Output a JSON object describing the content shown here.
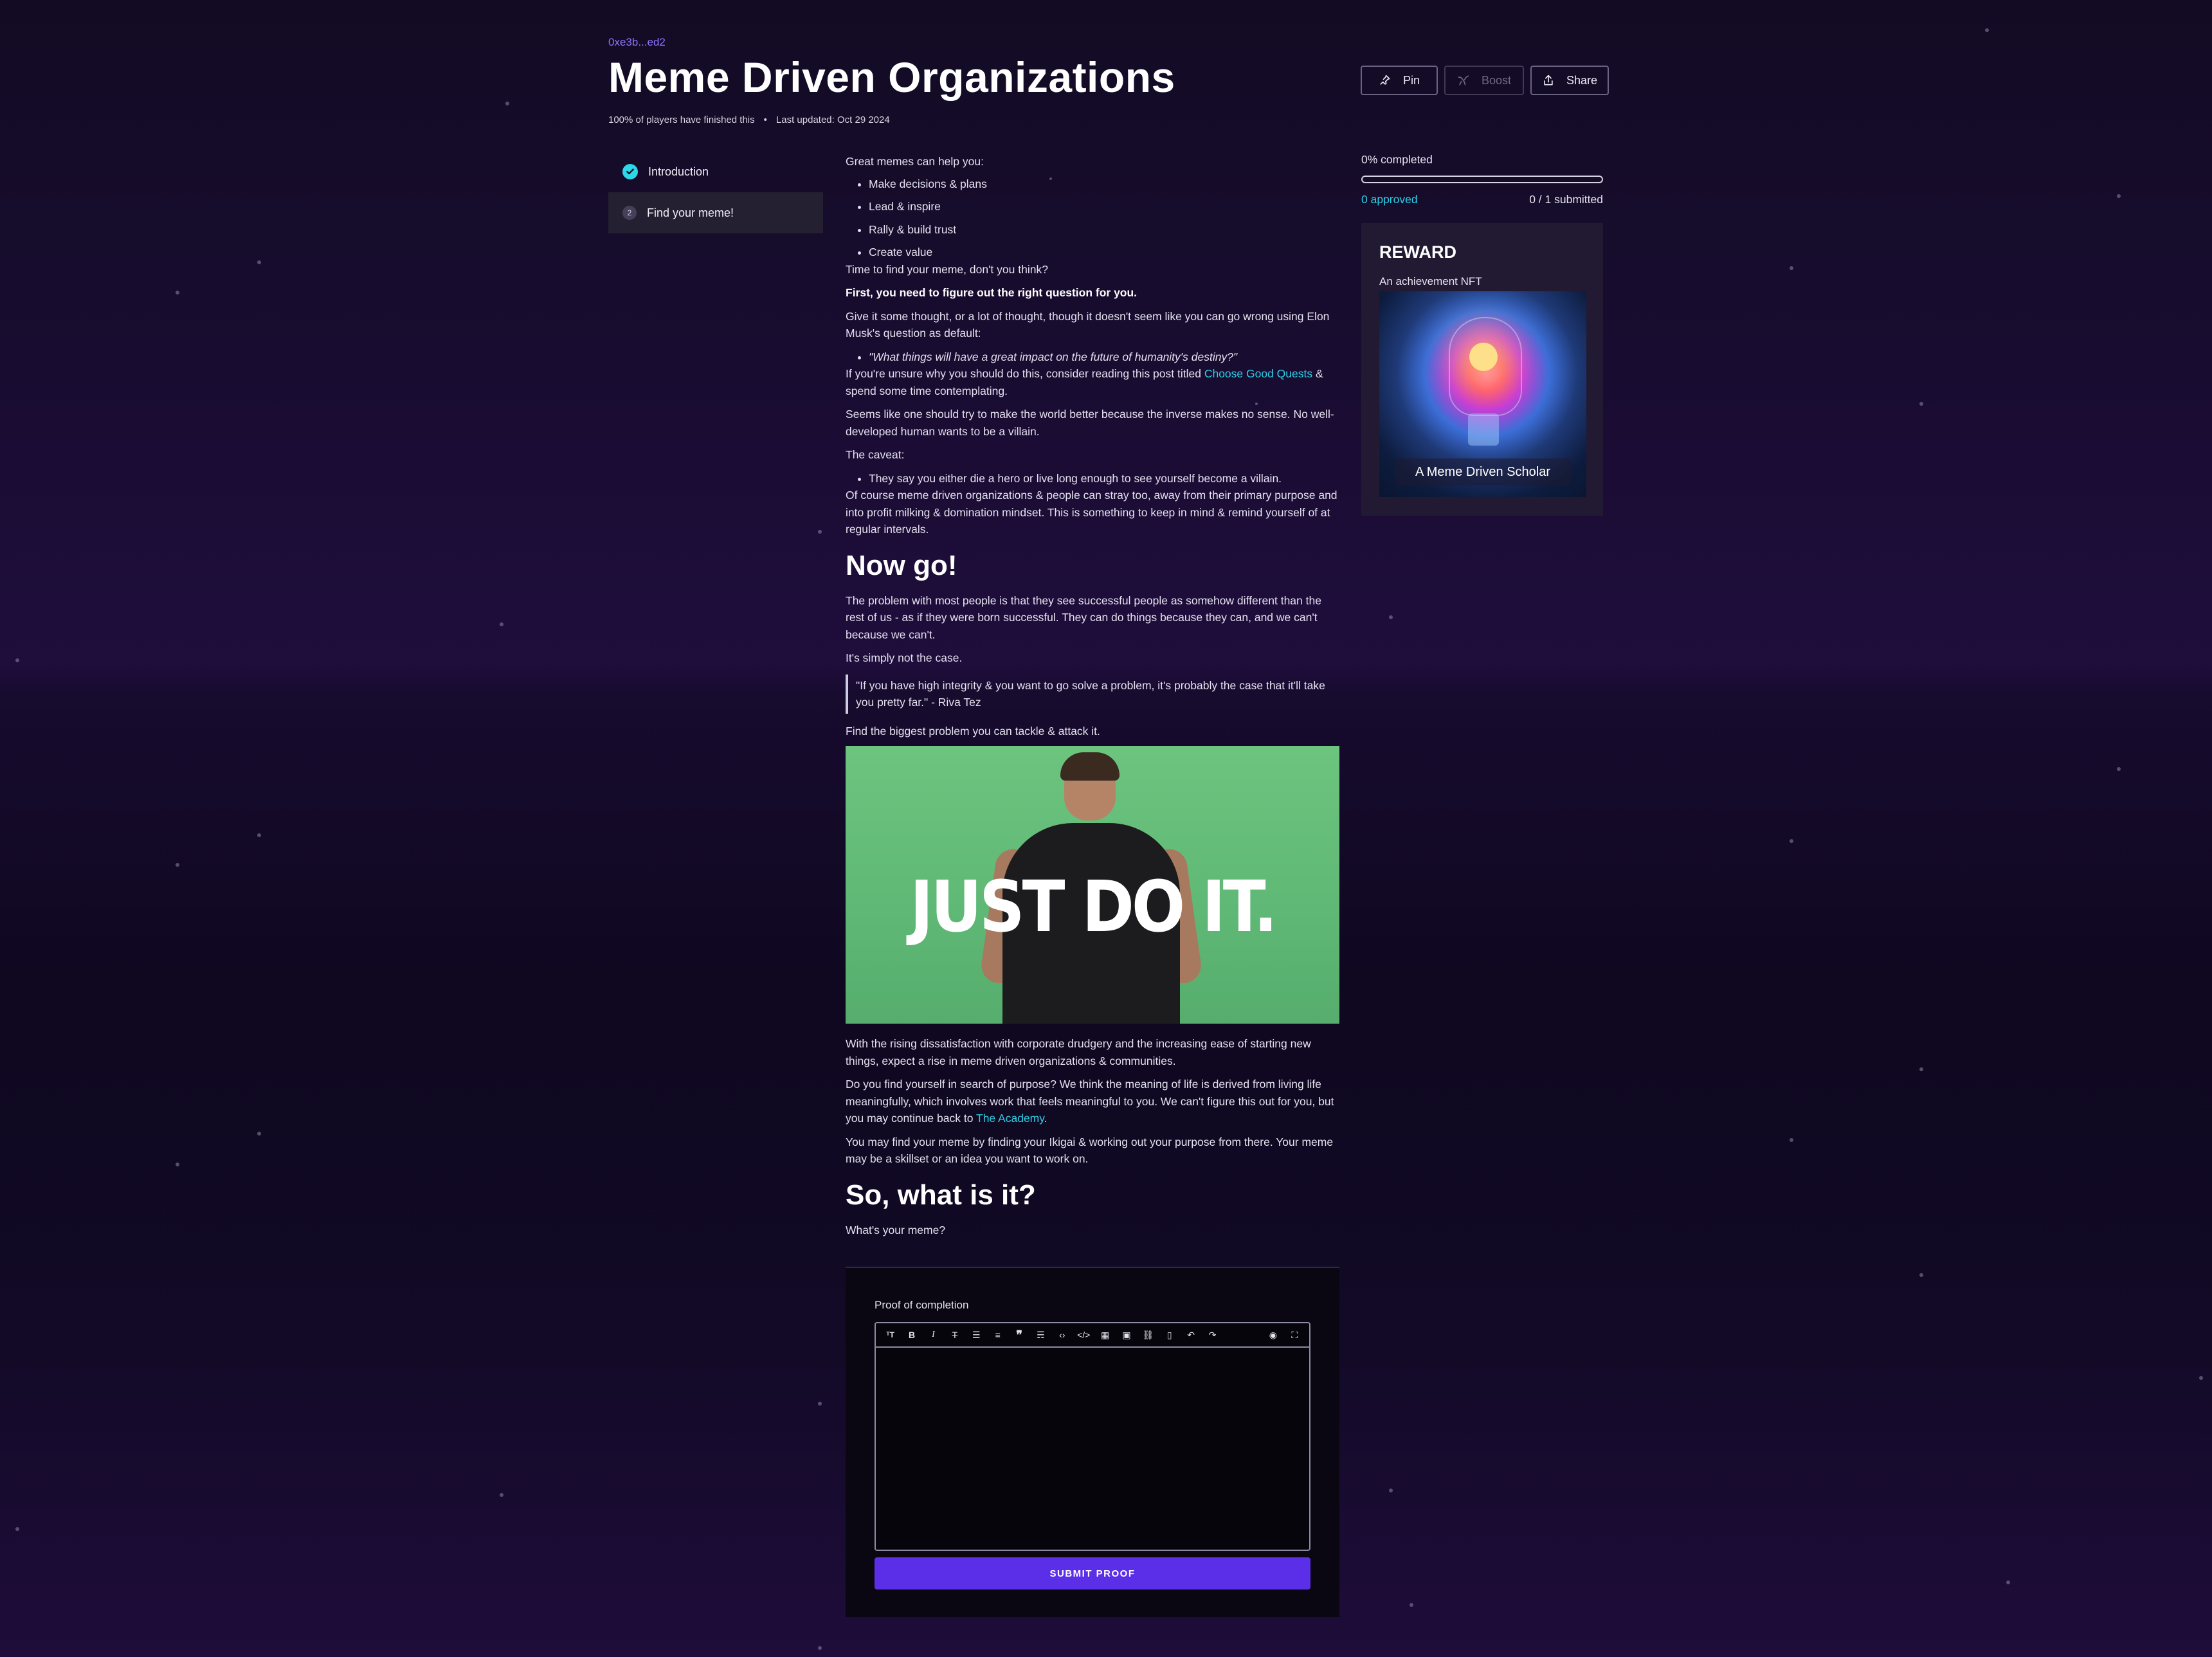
{
  "header": {
    "address": "0xe3b...ed2",
    "title": "Meme Driven Organizations",
    "players_finished": "100% of players have finished this",
    "separator": "•",
    "last_updated": "Last updated: Oct 29 2024",
    "buttons": {
      "pin": "Pin",
      "boost": "Boost",
      "share": "Share"
    }
  },
  "steps": [
    {
      "number": "1",
      "label": "Introduction",
      "status": "done"
    },
    {
      "number": "2",
      "label": "Find your meme!",
      "status": "active"
    }
  ],
  "content": {
    "intro": "Great memes can help you:",
    "benefits": [
      "Make decisions & plans",
      "Lead & inspire",
      "Rally & build trust",
      "Create value"
    ],
    "p_time": "Time to find your meme, don't you think?",
    "p_first": "First, you need to figure out the right question for you.",
    "p_thought": "Give it some thought, or a lot of thought, though it doesn't seem like you can go wrong using Elon Musk's question as default:",
    "q_default": "\"What things will have a great impact on the future of humanity's destiny?\"",
    "p_unsure_a": "If you're unsure why you should do this, consider reading this post titled ",
    "link_choose": "Choose Good Quests",
    "p_unsure_b": " & spend some time contemplating.",
    "p_better": "Seems like one should try to make the world better because the inverse makes no sense. No well-developed human wants to be a villain.",
    "p_caveat": "The caveat:",
    "caveat_item": "They say you either die a hero or live long enough to see yourself become a villain.",
    "p_stray": "Of course meme driven organizations & people can stray too, away from their primary purpose and into profit milking & domination mindset. This is something to keep in mind & remind yourself of at regular intervals.",
    "h_now": "Now go!",
    "p_problem": "The problem with most people is that they see successful people as somehow different than the rest of us - as if they were born successful. They can do things because they can, and we can't because we can't.",
    "p_simply": "It's simply not the case.",
    "quote": "\"If you have high integrity & you want to go solve a problem, it's probably the case that it'll take you pretty far.\" - Riva Tez",
    "p_find": "Find the biggest problem you can tackle & attack it.",
    "meme_caption": "JUST DO IT.",
    "p_rising": "With the rising dissatisfaction with corporate drudgery and the increasing ease of starting new things, expect a rise in meme driven organizations & communities.",
    "p_purpose_a": "Do you find yourself in search of purpose? We think the meaning of life is derived from living life meaningfully, which involves work that feels meaningful to you. We can't figure this out for you, but you may continue back to ",
    "link_academy": "The Academy",
    "p_purpose_b": ".",
    "p_ikigai": "You may find your meme by finding your Ikigai & working out your purpose from there. Your meme may be a skillset or an idea you want to work on.",
    "h_what": "So, what is it?",
    "p_whats": "What's your meme?"
  },
  "proof": {
    "label": "Proof of completion",
    "toolbar_icons": [
      "heading-icon",
      "bold-icon",
      "italic-icon",
      "strikethrough-icon",
      "bullet-list-icon",
      "numbered-list-icon",
      "quote-icon",
      "horizontal-rule-icon",
      "code-icon",
      "code-block-icon",
      "table-icon",
      "image-icon",
      "link-icon",
      "clear-icon",
      "undo-icon",
      "redo-icon",
      "preview-icon",
      "fullscreen-icon"
    ],
    "submit_label": "SUBMIT PROOF"
  },
  "progress": {
    "completed_label": "0% completed",
    "completed_fraction": 0,
    "approved": "0 approved",
    "submitted": "0 / 1 submitted"
  },
  "reward": {
    "title": "REWARD",
    "subtitle": "An achievement NFT",
    "nft_name": "A Meme Driven Scholar"
  },
  "colors": {
    "accent": "#2ad0e6",
    "link": "#8b76ff",
    "submit": "#5b2fe8"
  }
}
